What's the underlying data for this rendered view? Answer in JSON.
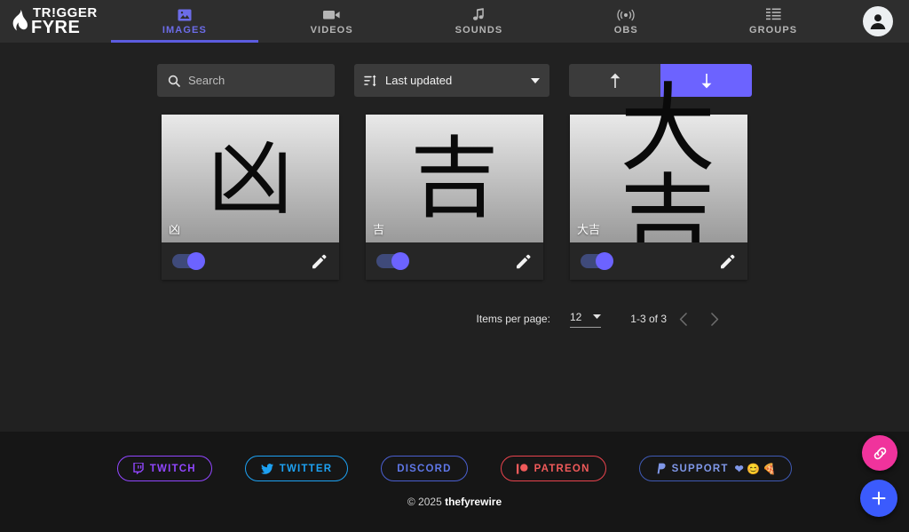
{
  "brand": {
    "line1": "TR!GGER",
    "line2": "FYRE",
    "flame_icon": "flame-icon"
  },
  "nav": {
    "tabs": [
      {
        "label": "IMAGES",
        "icon": "image-icon",
        "active": true
      },
      {
        "label": "VIDEOS",
        "icon": "video-icon",
        "active": false
      },
      {
        "label": "SOUNDS",
        "icon": "music-note-icon",
        "active": false
      },
      {
        "label": "OBS",
        "icon": "broadcast-icon",
        "active": false
      },
      {
        "label": "GROUPS",
        "icon": "grid-list-icon",
        "active": false
      }
    ],
    "avatar_icon": "user-avatar-icon"
  },
  "toolbar": {
    "search_placeholder": "Search",
    "search_value": "",
    "search_icon": "search-icon",
    "sort_icon": "sort-icon",
    "sort_value": "Last updated",
    "sort_options": [
      "Last updated"
    ],
    "dropdown_icon": "chevron-down-icon",
    "sort_asc_icon": "arrow-up-icon",
    "sort_desc_icon": "arrow-down-icon",
    "sort_direction": "descending"
  },
  "cards": [
    {
      "name": "凶",
      "glyph": "凶",
      "enabled": true,
      "edit_icon": "pencil-icon"
    },
    {
      "name": "吉",
      "glyph": "吉",
      "enabled": true,
      "edit_icon": "pencil-icon"
    },
    {
      "name": "大吉",
      "glyph": "大吉",
      "enabled": true,
      "edit_icon": "pencil-icon"
    }
  ],
  "paginator": {
    "items_per_page_label": "Items per page:",
    "items_per_page_value": "12",
    "range_label": "1-3 of 3",
    "prev_icon": "chevron-left-icon",
    "next_icon": "chevron-right-icon"
  },
  "footer": {
    "social": [
      {
        "label": "TWITCH",
        "icon": "twitch-icon",
        "color": "#9146ff"
      },
      {
        "label": "TWITTER",
        "icon": "twitter-icon",
        "color": "#1da1f2"
      },
      {
        "label": "DISCORD",
        "icon": "",
        "color": "#5f77e8"
      },
      {
        "label": "PATREON",
        "icon": "patreon-icon",
        "color": "#f05a5a"
      },
      {
        "label": "SUPPORT",
        "icon": "paypal-icon",
        "color": "#7f97e8",
        "emoji": "❤ 😊 🍕"
      }
    ],
    "copyright_prefix": "© 2025 ",
    "copyright_brand": "thefyrewire"
  },
  "fabs": {
    "link_icon": "link-icon",
    "add_icon": "plus-icon"
  },
  "colors": {
    "accent": "#6c63ff",
    "active_tab": "#6c6ce8",
    "background": "#212121",
    "header": "#2e2e2e",
    "footer": "#161616",
    "fab_link": "#f0339c",
    "fab_add": "#3b5bfd"
  }
}
